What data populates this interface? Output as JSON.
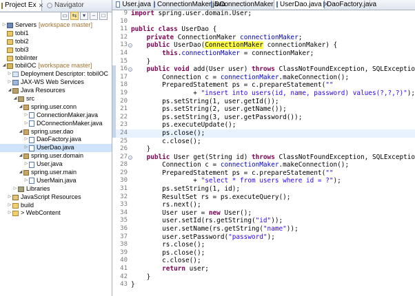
{
  "left_tabs": {
    "project_explorer": "Project Ex",
    "navigator": "Navigator"
  },
  "tree": [
    {
      "depth": 0,
      "arrow": "closed",
      "icon": "server",
      "label": "Servers",
      "note": "[workspace master]"
    },
    {
      "depth": 0,
      "arrow": "none",
      "icon": "project",
      "label": "tobi1",
      "note": ""
    },
    {
      "depth": 0,
      "arrow": "none",
      "icon": "project",
      "label": "tobi2",
      "note": ""
    },
    {
      "depth": 0,
      "arrow": "none",
      "icon": "project",
      "label": "tobi3",
      "note": ""
    },
    {
      "depth": 0,
      "arrow": "none",
      "icon": "project",
      "label": "tobiInter",
      "note": ""
    },
    {
      "depth": 0,
      "arrow": "open",
      "icon": "webproj",
      "label": "tobiIOC",
      "note": "[workspace master]"
    },
    {
      "depth": 1,
      "arrow": "closed",
      "icon": "dd",
      "label": "Deployment Descriptor: tobiIOC",
      "note": ""
    },
    {
      "depth": 1,
      "arrow": "closed",
      "icon": "ws",
      "label": "JAX-WS Web Services",
      "note": ""
    },
    {
      "depth": 1,
      "arrow": "open",
      "icon": "pkgroot",
      "label": "Java Resources",
      "note": ""
    },
    {
      "depth": 2,
      "arrow": "open",
      "icon": "pkgroot",
      "label": "src",
      "note": ""
    },
    {
      "depth": 3,
      "arrow": "open",
      "icon": "pkg",
      "label": "spring.user.conn",
      "note": ""
    },
    {
      "depth": 4,
      "arrow": "closed",
      "icon": "java",
      "label": "ConnectionMaker.java",
      "note": ""
    },
    {
      "depth": 4,
      "arrow": "closed",
      "icon": "java",
      "label": "DConnectionMaker.java",
      "note": ""
    },
    {
      "depth": 3,
      "arrow": "open",
      "icon": "pkg",
      "label": "spring.user.dao",
      "note": ""
    },
    {
      "depth": 4,
      "arrow": "closed",
      "icon": "java",
      "label": "DaoFactory.java",
      "note": ""
    },
    {
      "depth": 4,
      "arrow": "closed",
      "icon": "java",
      "label": "UserDao.java",
      "note": "",
      "selected": true
    },
    {
      "depth": 3,
      "arrow": "open",
      "icon": "pkg",
      "label": "spring.user.domain",
      "note": ""
    },
    {
      "depth": 4,
      "arrow": "closed",
      "icon": "java",
      "label": "User.java",
      "note": ""
    },
    {
      "depth": 3,
      "arrow": "open",
      "icon": "pkg",
      "label": "spring.user.main",
      "note": ""
    },
    {
      "depth": 4,
      "arrow": "closed",
      "icon": "java",
      "label": "UserMain.java",
      "note": ""
    },
    {
      "depth": 2,
      "arrow": "closed",
      "icon": "lib",
      "label": "Libraries",
      "note": ""
    },
    {
      "depth": 0,
      "arrow": "closed",
      "icon": "js",
      "label": "JavaScript Resources",
      "note": "",
      "indent": 1
    },
    {
      "depth": 0,
      "arrow": "closed",
      "icon": "folder",
      "label": "build",
      "note": "",
      "indent": 1
    },
    {
      "depth": 0,
      "arrow": "closed",
      "icon": "folder",
      "label": "> WebContent",
      "note": "",
      "indent": 1
    }
  ],
  "editor_tabs": [
    {
      "label": "User.java",
      "active": false
    },
    {
      "label": "ConnectionMaker.java",
      "active": false
    },
    {
      "label": "DConnectionMaker.java",
      "active": false
    },
    {
      "label": "UserDao.java",
      "active": true
    },
    {
      "label": "DaoFactory.java",
      "active": false
    }
  ],
  "code_lines": [
    {
      "n": "9",
      "html": "<span class=\"kw\">import</span> spring.user.domain.User;"
    },
    {
      "n": "10",
      "html": ""
    },
    {
      "n": "11",
      "html": "<span class=\"kw\">public</span> <span class=\"kw\">class</span> UserDao {"
    },
    {
      "n": "12",
      "html": "    <span class=\"kw\">private</span> ConnectionMaker <span class=\"fld\">connectionMaker</span>;"
    },
    {
      "n": "13",
      "fold": "-",
      "html": "    <span class=\"kw\">public</span> UserDao(<span class=\"hl\">ConnectionMaker</span> connectionMaker) {"
    },
    {
      "n": "14",
      "html": "        <span class=\"kw\">this</span>.<span class=\"fld\">connectionMaker</span> = connectionMaker;"
    },
    {
      "n": "15",
      "html": "    }"
    },
    {
      "n": "16",
      "fold": "-",
      "bar": true,
      "html": "    <span class=\"kw\">public</span> <span class=\"kw\">void</span> add(User user) <span class=\"kw\">throws</span> ClassNotFoundException, SQLException {"
    },
    {
      "n": "17",
      "bar": true,
      "html": "        Connection c = <span class=\"fld\">connectionMaker</span>.makeConnection();"
    },
    {
      "n": "18",
      "bar": true,
      "html": "        PreparedStatement ps = c.prepareStatement(<span class=\"str\">\"\"</span>"
    },
    {
      "n": "19",
      "bar": true,
      "html": "                + <span class=\"str\">\"insert into users(id, name, password) values(?,?,?)\"</span>);"
    },
    {
      "n": "20",
      "bar": true,
      "html": "        ps.setString(1, user.getId());"
    },
    {
      "n": "21",
      "bar": true,
      "html": "        ps.setString(2, user.getName());"
    },
    {
      "n": "22",
      "bar": true,
      "html": "        ps.setString(3, user.getPassword());"
    },
    {
      "n": "23",
      "bar": true,
      "html": "        ps.executeUpdate();"
    },
    {
      "n": "24",
      "bar": true,
      "cur": true,
      "html": "        ps.close();"
    },
    {
      "n": "25",
      "html": "        c.close();"
    },
    {
      "n": "26",
      "html": "    }"
    },
    {
      "n": "27",
      "fold": "-",
      "html": "    <span class=\"kw\">public</span> User get(String id) <span class=\"kw\">throws</span> ClassNotFoundException, SQLException {"
    },
    {
      "n": "28",
      "html": "        Connection c = <span class=\"fld\">connectionMaker</span>.makeConnection();"
    },
    {
      "n": "29",
      "html": "        PreparedStatement ps = c.prepareStatement(<span class=\"str\">\"\"</span>"
    },
    {
      "n": "30",
      "html": "                + <span class=\"str\">\"select * from users where id = ?\"</span>);"
    },
    {
      "n": "31",
      "html": "        ps.setString(1, id);"
    },
    {
      "n": "32",
      "html": "        ResultSet rs = ps.executeQuery();"
    },
    {
      "n": "33",
      "html": "        rs.next();"
    },
    {
      "n": "34",
      "html": "        User user = <span class=\"kw\">new</span> User();"
    },
    {
      "n": "35",
      "html": "        user.setId(rs.getString(<span class=\"str\">\"id\"</span>));"
    },
    {
      "n": "36",
      "html": "        user.setName(rs.getString(<span class=\"str\">\"name\"</span>));"
    },
    {
      "n": "37",
      "html": "        user.setPassword(<span class=\"str\">\"password\"</span>);"
    },
    {
      "n": "38",
      "html": "        rs.close();"
    },
    {
      "n": "39",
      "html": "        ps.close();"
    },
    {
      "n": "40",
      "html": "        c.close();"
    },
    {
      "n": "41",
      "html": "        <span class=\"kw\">return</span> user;"
    },
    {
      "n": "42",
      "html": "    }"
    },
    {
      "n": "43",
      "html": "}"
    }
  ]
}
